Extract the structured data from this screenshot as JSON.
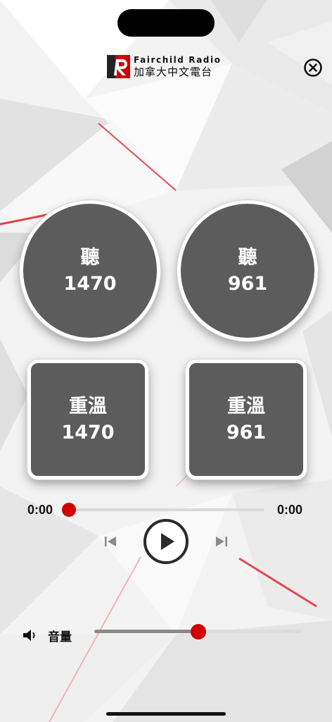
{
  "header": {
    "brand_en": "Fairchild Radio",
    "brand_zh": "加拿大中文電台",
    "logo_letter": "R",
    "close_icon": "close-circle-icon"
  },
  "live": [
    {
      "label": "聽",
      "station": "1470"
    },
    {
      "label": "聽",
      "station": "961"
    }
  ],
  "replay": [
    {
      "label": "重溫",
      "station": "1470"
    },
    {
      "label": "重溫",
      "station": "961"
    }
  ],
  "player": {
    "elapsed": "0:00",
    "duration": "0:00",
    "progress": 0,
    "prev_icon": "skip-previous-icon",
    "play_icon": "play-icon",
    "next_icon": "skip-next-icon"
  },
  "volume": {
    "label": "音量",
    "icon": "speaker-icon",
    "level": 0.5
  },
  "colors": {
    "accent": "#d10000",
    "button_fill": "#5c5c5c",
    "text": "#111111"
  }
}
